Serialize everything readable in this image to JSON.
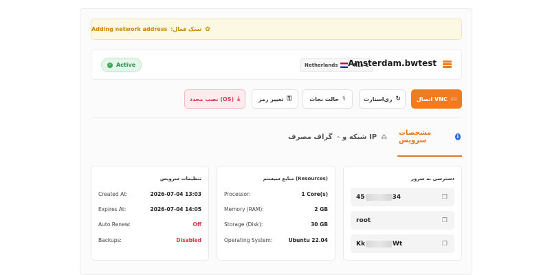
{
  "task": {
    "label": "تسک فعال:",
    "value": "Adding network address",
    "icon": "gear-icon"
  },
  "server": {
    "status": "Active",
    "hostname": "Amsterdam.bwtest",
    "plan": "NLs-1",
    "location": "Netherlands",
    "icon": "server-icon"
  },
  "actions": {
    "vnc": "اتصال VNC",
    "restart": "ری‌استارت",
    "rescue": "حالت نجات",
    "change_password": "تغییر رمز",
    "reinstall": "نصب مجدد (OS)"
  },
  "tabs": [
    {
      "label": "مشخصات سرویس",
      "icon": "info-icon"
    },
    {
      "label": "شبکه و IP",
      "icon": "network-icon"
    },
    {
      "label": "گراف مصرف",
      "icon": "chart-icon"
    }
  ],
  "access": {
    "title": "دسترسی به سرور",
    "ip_prefix": "45",
    "ip_suffix": "34",
    "username": "root",
    "password_prefix": "Kk",
    "password_suffix": "Wt"
  },
  "resources": {
    "title": "منابع سیستم (Resources)",
    "rows": [
      {
        "key": "Processor:",
        "value": "1 Core(s)"
      },
      {
        "key": "Memory (RAM):",
        "value": "2 GB"
      },
      {
        "key": "Storage (Disk):",
        "value": "30 GB"
      },
      {
        "key": "Operating System:",
        "value": "Ubuntu 22.04"
      }
    ]
  },
  "settings": {
    "title": "تنظیمات سرویس",
    "rows": [
      {
        "key": "Created At:",
        "value": "2026-07-04 13:03"
      },
      {
        "key": "Expires At:",
        "value": "2026-07-04 14:05"
      },
      {
        "key": "Auto Renew:",
        "value": "Off"
      },
      {
        "key": "Backups:",
        "value": "Disabled"
      }
    ]
  },
  "colors": {
    "accent": "#f27b1f",
    "success": "#2f8a4a",
    "danger": "#d9364a",
    "warning_bg": "#fdf8e4"
  }
}
